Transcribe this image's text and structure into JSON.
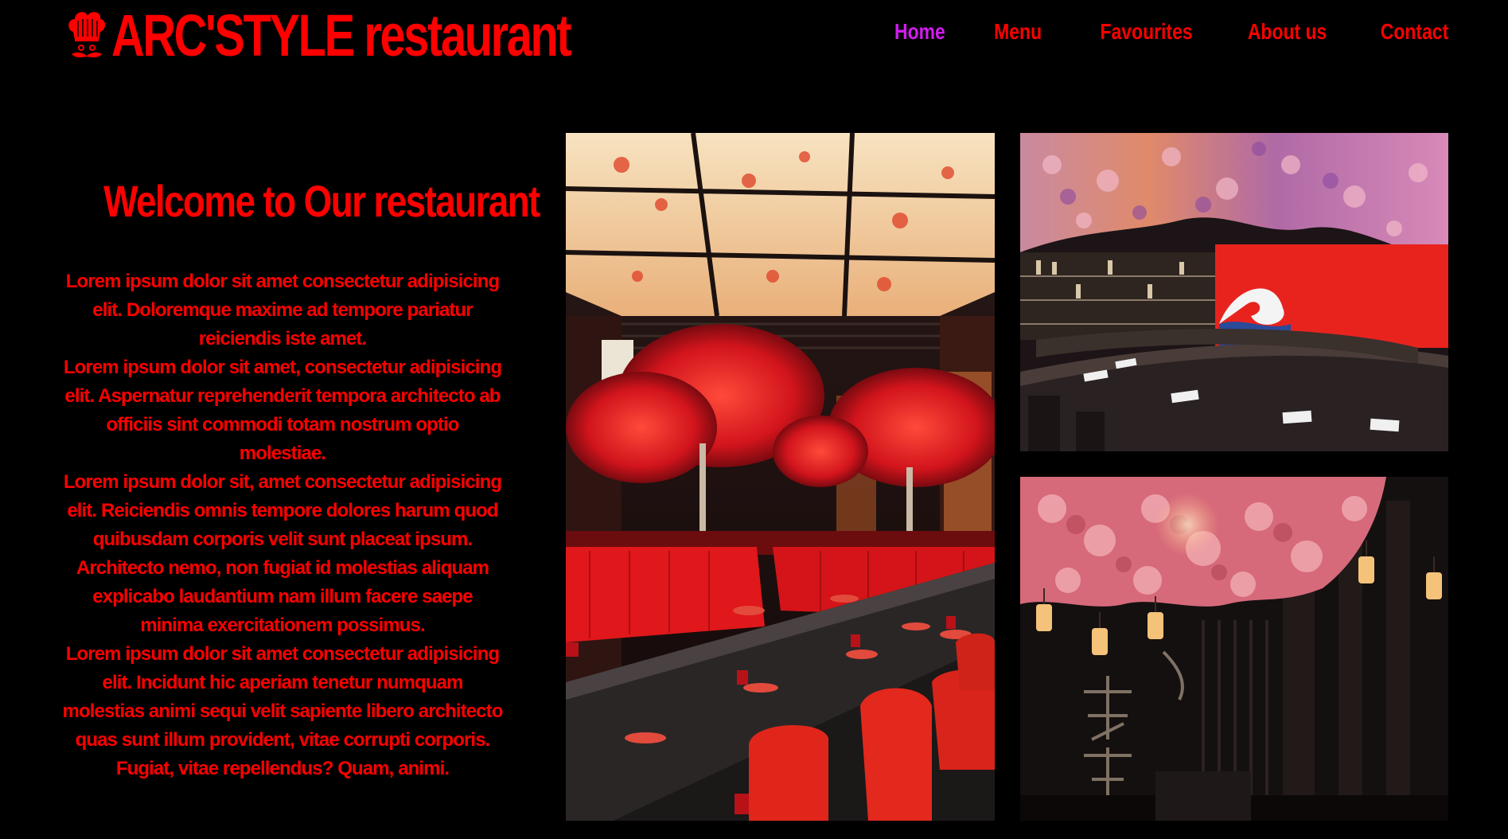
{
  "header": {
    "logo_text": "ARC'STYLE restaurant",
    "logo_icon": "chef-hat-mustache-icon"
  },
  "nav": {
    "items": [
      {
        "label": "Home",
        "active": true
      },
      {
        "label": "Menu",
        "active": false
      },
      {
        "label": "Favourites",
        "active": false
      },
      {
        "label": "About us",
        "active": false
      },
      {
        "label": "Contact",
        "active": false
      }
    ]
  },
  "welcome": {
    "title": "Welcome to Our restaurant",
    "paragraphs": [
      "Lorem ipsum dolor sit amet consectetur adipisicing elit. Doloremque maxime ad tempore pariatur reiciendis iste amet.",
      "Lorem ipsum dolor sit amet, consectetur adipisicing elit. Aspernatur reprehenderit tempora architecto ab officiis sint commodi totam nostrum optio molestiae.",
      "Lorem ipsum dolor sit, amet consectetur adipisicing elit. Reiciendis omnis tempore dolores harum quod quibusdam corporis velit sunt placeat ipsum. Architecto nemo, non fugiat id molestias aliquam explicabo laudantium nam illum facere saepe minima exercitationem possimus.",
      "Lorem ipsum dolor sit amet consectetur adipisicing elit. Incidunt hic aperiam tenetur numquam molestias animi sequi velit sapiente libero architecto quas sunt illum provident, vitae corrupti corporis. Fugiat, vitae repellendus? Quam, animi."
    ]
  },
  "colors": {
    "background": "#000000",
    "accent": "#ff0000",
    "active_nav": "#d21cf0"
  }
}
